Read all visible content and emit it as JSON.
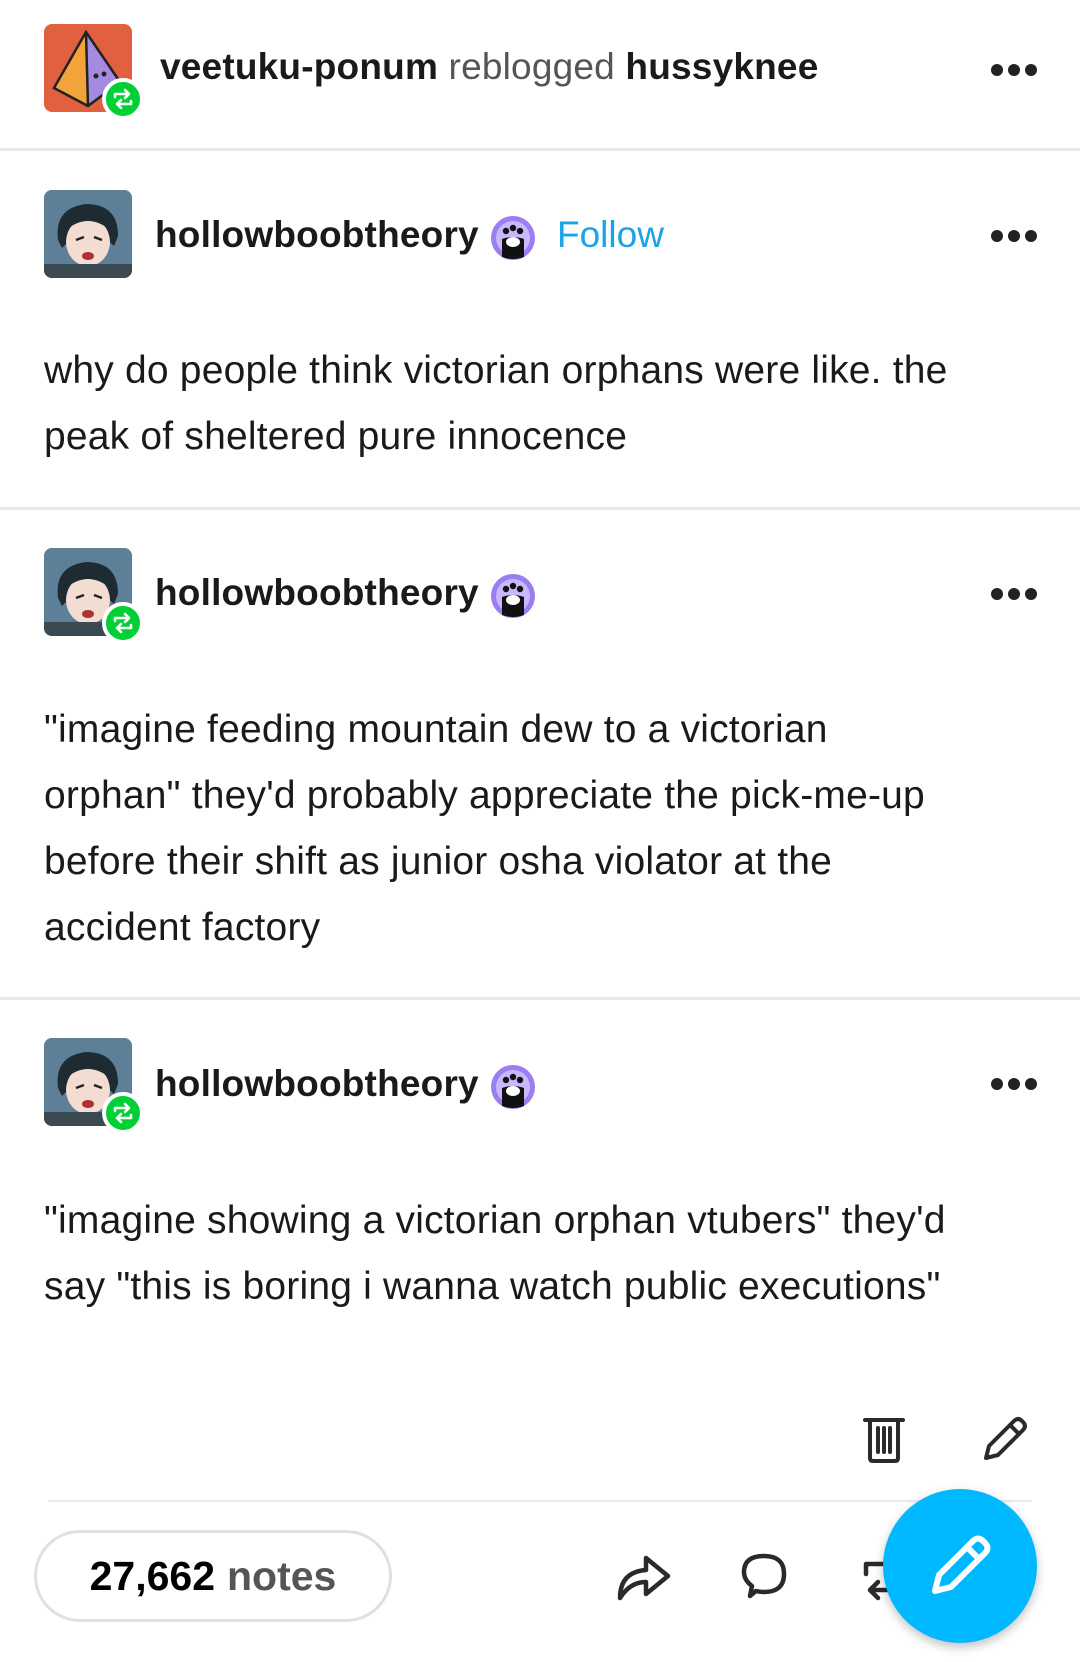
{
  "header": {
    "reblogger": "veetuku-ponum",
    "action": "reblogged",
    "source": "hussyknee",
    "more_icon": "more-horizontal-icon"
  },
  "posts": [
    {
      "author": "hollowboobtheory",
      "follow_label": "Follow",
      "badge_icon": "paw-badge-icon",
      "text": "why do people think victorian orphans were like. the peak of sheltered pure innocence"
    },
    {
      "author": "hollowboobtheory",
      "badge_icon": "paw-badge-icon",
      "text": "\"imagine feeding mountain dew to a victorian orphan\" they'd probably appreciate the pick-me-up before their shift as junior osha violator at the accident factory"
    },
    {
      "author": "hollowboobtheory",
      "badge_icon": "paw-badge-icon",
      "text": "\"imagine showing a victorian orphan vtubers\" they'd say \"this is boring i wanna watch public executions\""
    }
  ],
  "footer": {
    "notes_count": "27,662",
    "notes_label": "notes",
    "actions": [
      "delete-icon",
      "edit-icon",
      "share-icon",
      "reply-icon",
      "reblog-icon",
      "compose-icon"
    ]
  },
  "colors": {
    "link_blue": "#1aa3e8",
    "reblog_green": "#00cf35",
    "fab_blue": "#00b8ff",
    "header_avatar": "#e0603f"
  }
}
